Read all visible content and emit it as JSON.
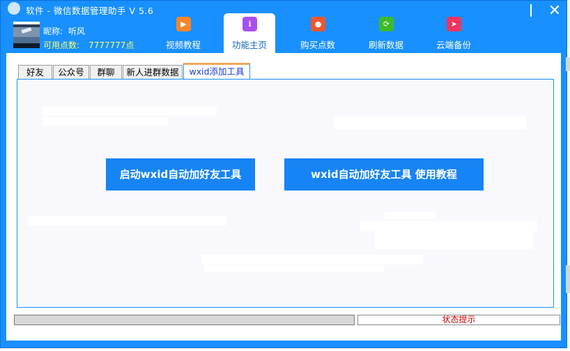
{
  "window": {
    "title": "软件 - 微信数据管理助手 V 5.6",
    "close_glyph": "✕"
  },
  "user": {
    "nickname_label": "昵称:",
    "nickname": "听风",
    "points_label": "可用点数:",
    "points": "7777777点"
  },
  "nav": {
    "tabs": [
      {
        "label": "视频教程",
        "icon": "video-icon",
        "glyph": "▶",
        "color": "#f5862a"
      },
      {
        "label": "功能主页",
        "icon": "info-icon",
        "glyph": "ℹ",
        "color": "#a94ff0",
        "active": true
      },
      {
        "label": "购买点数",
        "icon": "coin-icon",
        "glyph": "●",
        "color": "#f0562e"
      },
      {
        "label": "刷新数据",
        "icon": "refresh-icon",
        "glyph": "⟳",
        "color": "#3cba2a"
      },
      {
        "label": "云端备份",
        "icon": "send-icon",
        "glyph": "➤",
        "color": "#f0335f"
      }
    ]
  },
  "subtabs": [
    "好友",
    "公众号",
    "群聊",
    "新人进群数据",
    "wxid添加工具"
  ],
  "active_subtab": "wxid添加工具",
  "actions": {
    "start_button": "启动wxid自动加好友工具",
    "tutorial_button": "wxid自动加好友工具 使用教程"
  },
  "footer": {
    "progress": 0,
    "status": "状态提示"
  },
  "colors": {
    "accent": "#1890ff",
    "button": "#1684f5",
    "status_text": "#cc0000",
    "points_text": "#ffff66"
  }
}
